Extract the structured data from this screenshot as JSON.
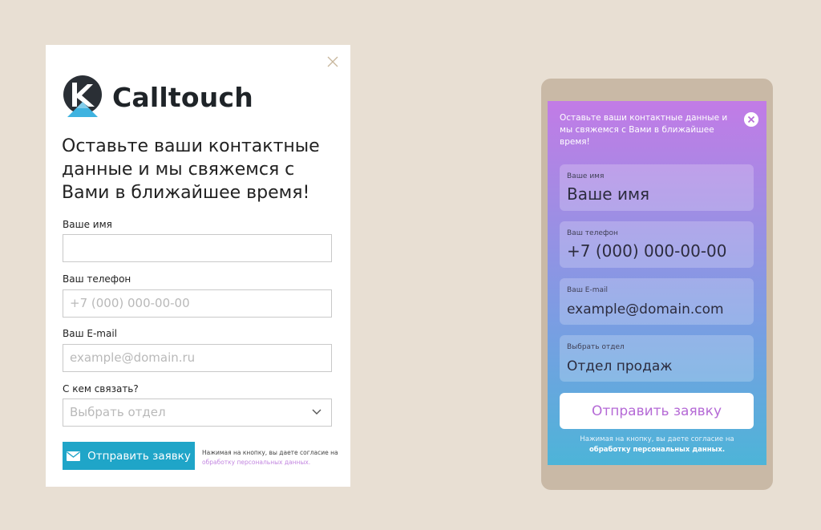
{
  "desktop": {
    "brand": "Calltouch",
    "heading": "Оставьте ваши контактные данные и мы свяжемся с Вами в ближайшее время!",
    "name_label": "Ваше имя",
    "name_value": "",
    "phone_label": "Ваш телефон",
    "phone_placeholder": "+7 (000) 000-00-00",
    "email_label": "Ваш E-mail",
    "email_placeholder": "example@domain.ru",
    "contact_label": "С кем связать?",
    "contact_placeholder": "Выбрать отдел",
    "submit_label": "Отправить заявку",
    "consent_text": "Нажимая на кнопку, вы даете согласие на",
    "consent_link": "обработку персональных данных."
  },
  "mobile": {
    "heading": "Оставьте ваши контактные данные и мы свяжемся с Вами в ближайшее время!",
    "name_label": "Ваше имя",
    "name_value": "Ваше имя",
    "phone_label": "Ваш телефон",
    "phone_value": "+7 (000) 000-00-00",
    "email_label": "Ваш E-mail",
    "email_value": "example@domain.com",
    "dept_label": "Выбрать отдел",
    "dept_value": "Отдел продаж",
    "submit_label": "Отправить заявку",
    "consent_text": "Нажимая на кнопку, вы даете согласие на",
    "consent_link": "обработку персональных данных."
  },
  "colors": {
    "page_bg": "#e8dfd3",
    "submit_bg": "#1fa5c8",
    "link": "#c387e0",
    "phone_frame": "#c9b9a6",
    "mobile_button_text": "#b56ad6"
  }
}
